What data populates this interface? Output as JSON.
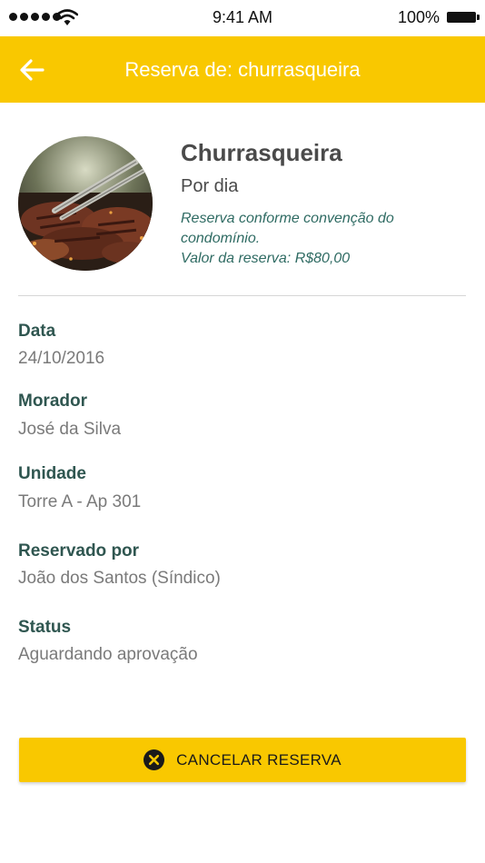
{
  "status_bar": {
    "time": "9:41 AM",
    "battery_percent": "100%"
  },
  "header": {
    "title": "Reserva de: churrasqueira",
    "back_icon": "arrow-left-icon"
  },
  "venue": {
    "name": "Churrasqueira",
    "period": "Por dia",
    "rules": "Reserva conforme convenção do condomínio.",
    "price": "Valor da reserva: R$80,00"
  },
  "fields": [
    {
      "label": "Data",
      "value": "24/10/2016"
    },
    {
      "label": "Morador",
      "value": "José da Silva"
    },
    {
      "label": "Unidade",
      "value": "Torre A - Ap 301"
    },
    {
      "label": "Reservado por",
      "value": "João dos Santos (Síndico)"
    },
    {
      "label": "Status",
      "value": "Aguardando aprovação"
    }
  ],
  "cancel_button": {
    "label": "CANCELAR RESERVA",
    "icon": "close-circle-icon"
  },
  "colors": {
    "accent": "#f9c800",
    "label": "#2f5650",
    "value": "#7a7a7a",
    "note": "#2f6b63"
  }
}
